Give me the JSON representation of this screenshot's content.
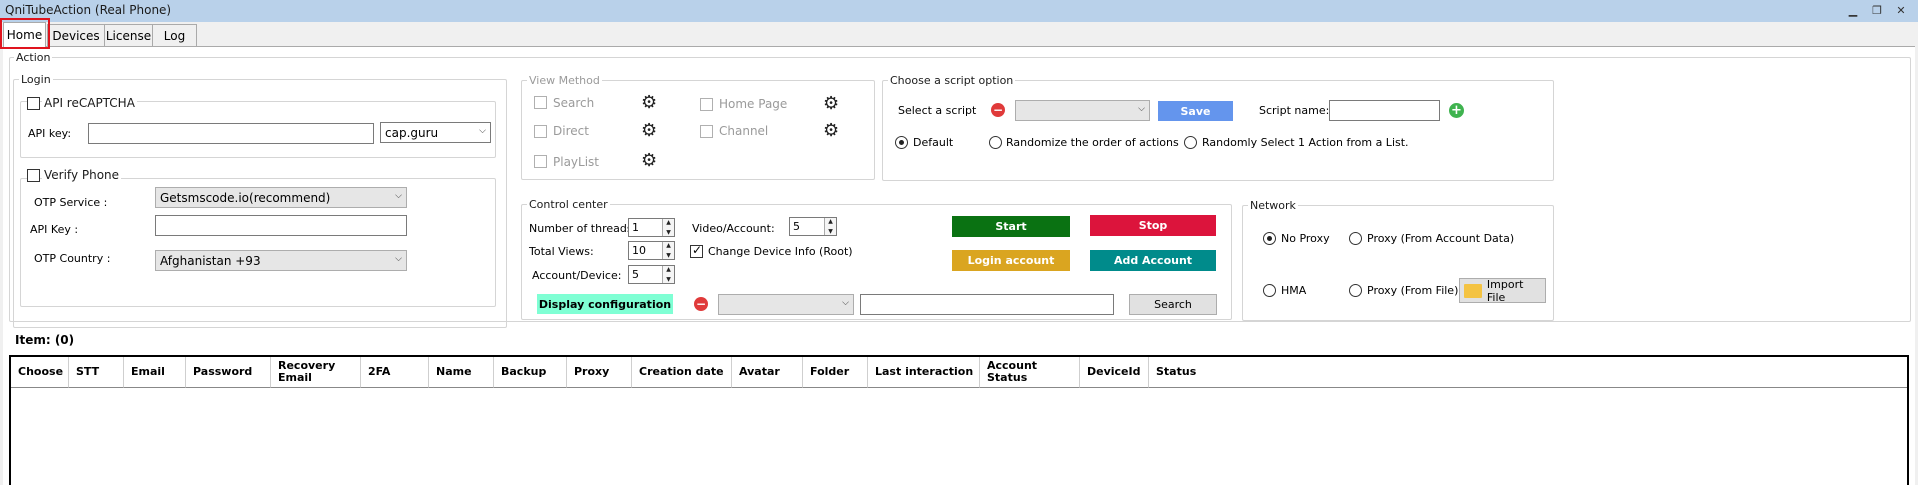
{
  "window": {
    "title": "QniTubeAction (Real Phone)"
  },
  "tabs": [
    "Home",
    "Devices",
    "License",
    "Log"
  ],
  "action_label": "Action",
  "login": {
    "label": "Login",
    "captcha_label": "API reCAPTCHA",
    "api_key_label": "API key:",
    "api_key_value": "",
    "captcha_provider": "cap.guru",
    "verify_phone_label": "Verify Phone",
    "otp_service_label": "OTP Service :",
    "otp_service_value": "Getsmscode.io(recommend)",
    "otp_api_key_label": "API Key :",
    "otp_api_key_value": "",
    "otp_country_label": "OTP Country :",
    "otp_country_value": "Afghanistan +93"
  },
  "view_method": {
    "label": "View Method",
    "search": "Search",
    "direct": "Direct",
    "playlist": "PlayList",
    "home_page": "Home Page",
    "channel": "Channel"
  },
  "script": {
    "label": "Choose a script option",
    "select_label": "Select a script",
    "select_value": "",
    "save": "Save",
    "name_label": "Script name:",
    "name_value": "",
    "opt_default": "Default",
    "opt_randomize": "Randomize the order of actions",
    "opt_random_one": "Randomly Select 1 Action from a List."
  },
  "control": {
    "label": "Control center",
    "threads_label": "Number of threads:",
    "threads_value": "1",
    "views_label": "Total Views:",
    "views_value": "10",
    "acc_dev_label": "Account/Device:",
    "acc_dev_value": "5",
    "video_acc_label": "Video/Account:",
    "video_acc_value": "5",
    "change_device_label": "Change Device Info (Root)",
    "start": "Start",
    "stop": "Stop",
    "login_account": "Login account",
    "add_account": "Add Account",
    "display_config": "Display configuration",
    "filter_value": "",
    "search_value": "",
    "search_button": "Search"
  },
  "network": {
    "label": "Network",
    "no_proxy": "No Proxy",
    "proxy_account": "Proxy (From Account Data)",
    "hma": "HMA",
    "proxy_file": "Proxy (From File)",
    "import_file": "Import File"
  },
  "items_label": "Item: (0)",
  "table": {
    "columns": [
      "Choose",
      "STT",
      "Email",
      "Password",
      "Recovery Email",
      "2FA",
      "Name",
      "Backup",
      "Proxy",
      "Creation date",
      "Avatar",
      "Folder",
      "Last interaction",
      "Account Status",
      "DeviceId",
      "Status"
    ],
    "rows": []
  },
  "colors": {
    "start": "#0a7212",
    "stop": "#dc143c",
    "login_account": "#daa520",
    "add_account": "#008b8b",
    "save": "#6495ed",
    "display_config": "#7fffd4"
  }
}
